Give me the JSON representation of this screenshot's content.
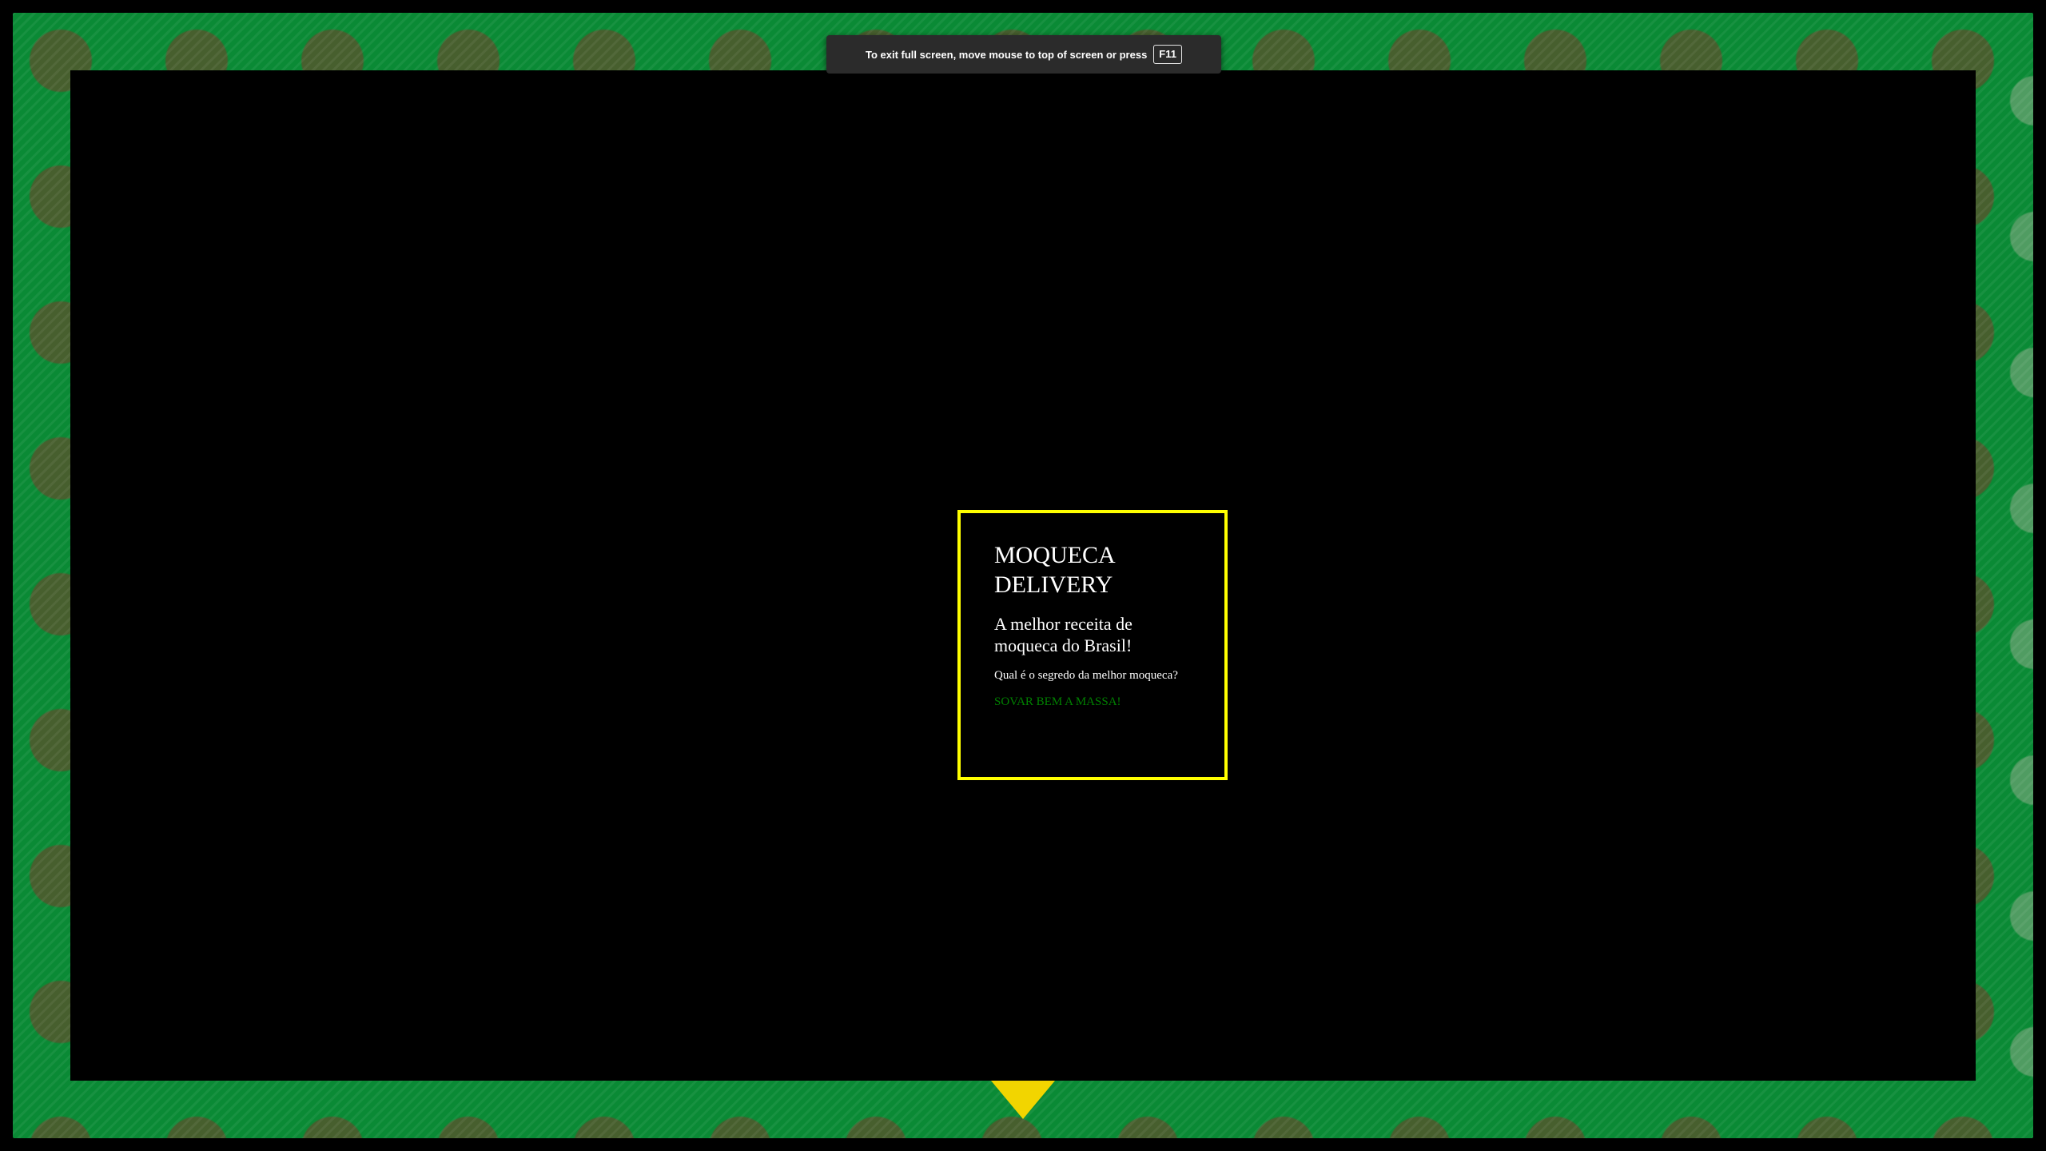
{
  "fullscreen_hint": {
    "text": "To exit full screen, move mouse to top of screen or press",
    "key": "F11"
  },
  "card": {
    "title": "MOQUECA DELIVERY",
    "subtitle": "A melhor receita de moqueca do Brasil!",
    "question": "Qual é o segredo da melhor moqueca?",
    "answer": "SOVAR BEM A MASSA!"
  },
  "colors": {
    "frame_green": "#0a8a35",
    "card_border": "#ffff00",
    "answer_text": "#008000",
    "background": "#000000"
  }
}
